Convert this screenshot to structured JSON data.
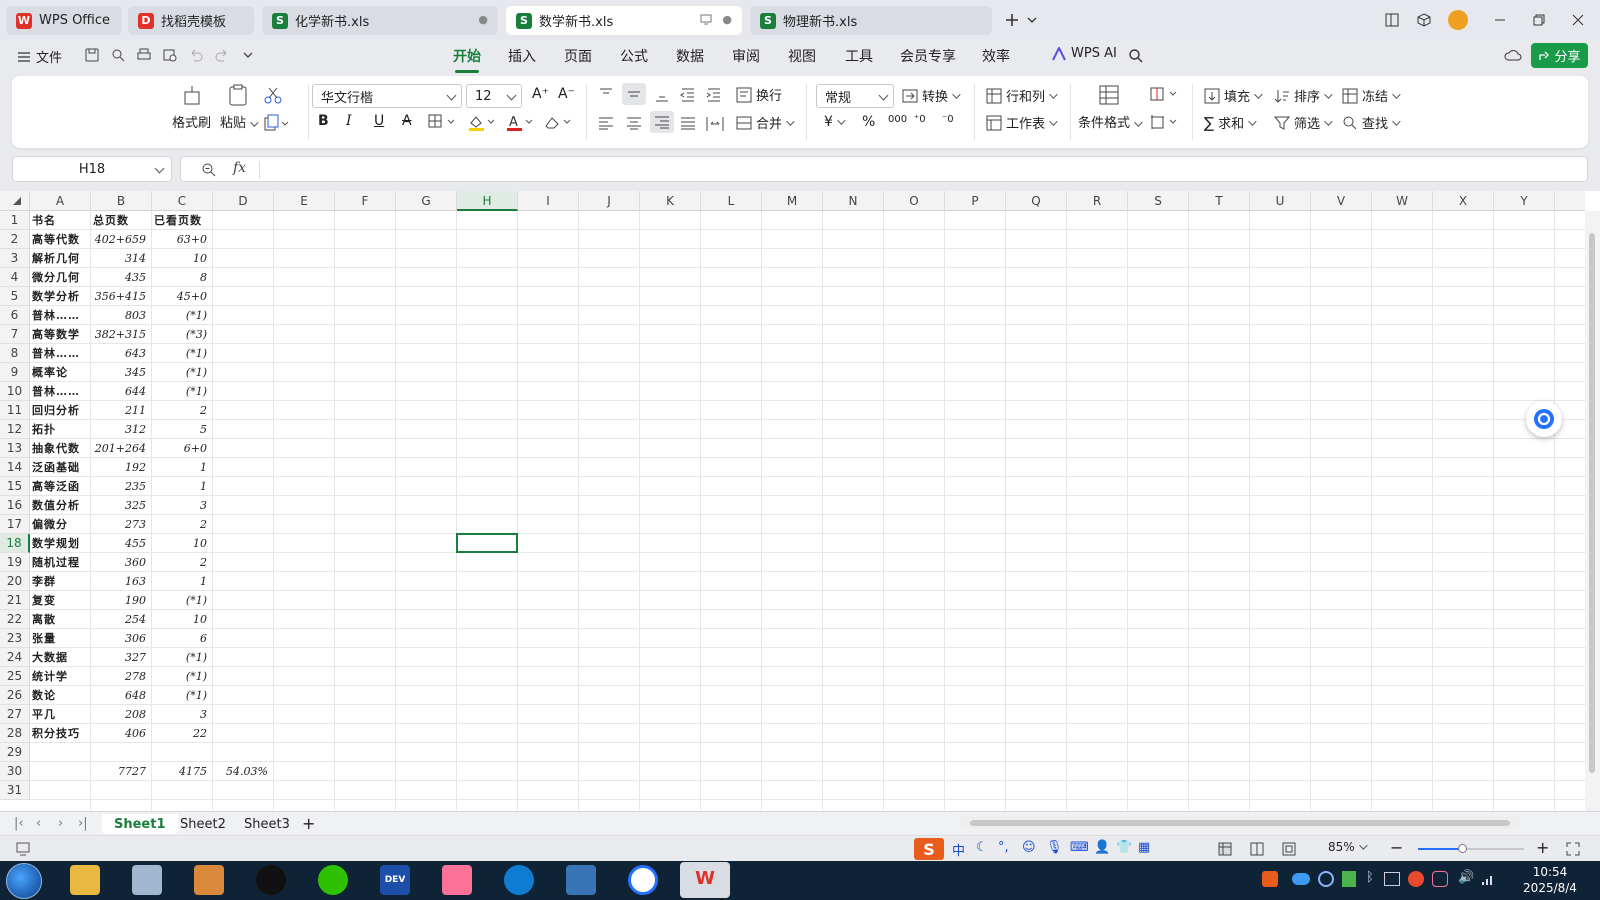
{
  "tabs": [
    {
      "label": "WPS Office",
      "color": "#e0312b",
      "logo": "W"
    },
    {
      "label": "找稻壳模板",
      "color": "#e0312b",
      "logo": "D"
    },
    {
      "label": "化学新书.xls",
      "color": "#1a7f3c",
      "logo": "S"
    },
    {
      "label": "数学新书.xls",
      "color": "#1a7f3c",
      "logo": "S",
      "active": true
    },
    {
      "label": "物理新书.xls",
      "color": "#1a7f3c",
      "logo": "S"
    }
  ],
  "menu": {
    "file": "文件",
    "items": [
      "开始",
      "插入",
      "页面",
      "公式",
      "数据",
      "审阅",
      "视图",
      "工具",
      "会员专享",
      "效率"
    ],
    "wps_ai": "WPS AI",
    "share": "分享"
  },
  "ribbon": {
    "format_painter": "格式刷",
    "paste": "粘贴",
    "font_name": "华文行楷",
    "font_size": "12",
    "wrap": "换行",
    "merge": "合并",
    "number_format": "常规",
    "convert": "转换",
    "row_col": "行和列",
    "worksheet": "工作表",
    "cond_format": "条件格式",
    "fill": "填充",
    "sort": "排序",
    "freeze": "冻结",
    "sum": "求和",
    "filter": "筛选",
    "find": "查找"
  },
  "formula_bar": {
    "name_box": "H18",
    "fx": "fx",
    "value": ""
  },
  "columns": [
    "A",
    "B",
    "C",
    "D",
    "E",
    "F",
    "G",
    "H",
    "I",
    "J",
    "K",
    "L",
    "M",
    "N",
    "O",
    "P",
    "Q",
    "R",
    "S",
    "T",
    "U",
    "V",
    "W",
    "X",
    "Y"
  ],
  "selected_column": "H",
  "selected_row": 18,
  "rows": [
    {
      "n": 1,
      "a": "书名",
      "b": "总页数",
      "c": "已看页数",
      "hdr": true
    },
    {
      "n": 2,
      "a": "高等代数",
      "b": "402+659",
      "c": "63+0"
    },
    {
      "n": 3,
      "a": "解析几何",
      "b": "314",
      "c": "10"
    },
    {
      "n": 4,
      "a": "微分几何",
      "b": "435",
      "c": "8"
    },
    {
      "n": 5,
      "a": "数学分析",
      "b": "356+415",
      "c": "45+0"
    },
    {
      "n": 6,
      "a": "普林……",
      "b": "803",
      "c": "(*1)"
    },
    {
      "n": 7,
      "a": "高等数学",
      "b": "382+315",
      "c": "(*3)"
    },
    {
      "n": 8,
      "a": "普林……",
      "b": "643",
      "c": "(*1)"
    },
    {
      "n": 9,
      "a": "概率论",
      "b": "345",
      "c": "(*1)"
    },
    {
      "n": 10,
      "a": "普林……",
      "b": "644",
      "c": "(*1)"
    },
    {
      "n": 11,
      "a": "回归分析",
      "b": "211",
      "c": "2"
    },
    {
      "n": 12,
      "a": "拓扑",
      "b": "312",
      "c": "5"
    },
    {
      "n": 13,
      "a": "抽象代数",
      "b": "201+264",
      "c": "6+0"
    },
    {
      "n": 14,
      "a": "泛函基础",
      "b": "192",
      "c": "1"
    },
    {
      "n": 15,
      "a": "高等泛函",
      "b": "235",
      "c": "1"
    },
    {
      "n": 16,
      "a": "数值分析",
      "b": "325",
      "c": "3"
    },
    {
      "n": 17,
      "a": "偏微分",
      "b": "273",
      "c": "2"
    },
    {
      "n": 18,
      "a": "数学规划",
      "b": "455",
      "c": "10"
    },
    {
      "n": 19,
      "a": "随机过程",
      "b": "360",
      "c": "2"
    },
    {
      "n": 20,
      "a": "李群",
      "b": "163",
      "c": "1"
    },
    {
      "n": 21,
      "a": "复变",
      "b": "190",
      "c": "(*1)"
    },
    {
      "n": 22,
      "a": "离散",
      "b": "254",
      "c": "10"
    },
    {
      "n": 23,
      "a": "张量",
      "b": "306",
      "c": "6"
    },
    {
      "n": 24,
      "a": "大数据",
      "b": "327",
      "c": "(*1)"
    },
    {
      "n": 25,
      "a": "统计学",
      "b": "278",
      "c": "(*1)"
    },
    {
      "n": 26,
      "a": "数论",
      "b": "648",
      "c": "(*1)"
    },
    {
      "n": 27,
      "a": "平几",
      "b": "208",
      "c": "3"
    },
    {
      "n": 28,
      "a": "积分技巧",
      "b": "406",
      "c": "22"
    },
    {
      "n": 29,
      "a": "",
      "b": "",
      "c": ""
    },
    {
      "n": 30,
      "a": "",
      "b": "7727",
      "c": "4175",
      "d": "54.03%"
    },
    {
      "n": 31,
      "a": "",
      "b": "",
      "c": ""
    }
  ],
  "sheets": [
    "Sheet1",
    "Sheet2",
    "Sheet3"
  ],
  "active_sheet": "Sheet1",
  "status": {
    "zoom": "85%"
  },
  "taskbar": {
    "time": "10:54",
    "date": "2025/8/4"
  },
  "colors": {
    "accent": "#1a7f3c",
    "taskbar": "#0f2336"
  }
}
